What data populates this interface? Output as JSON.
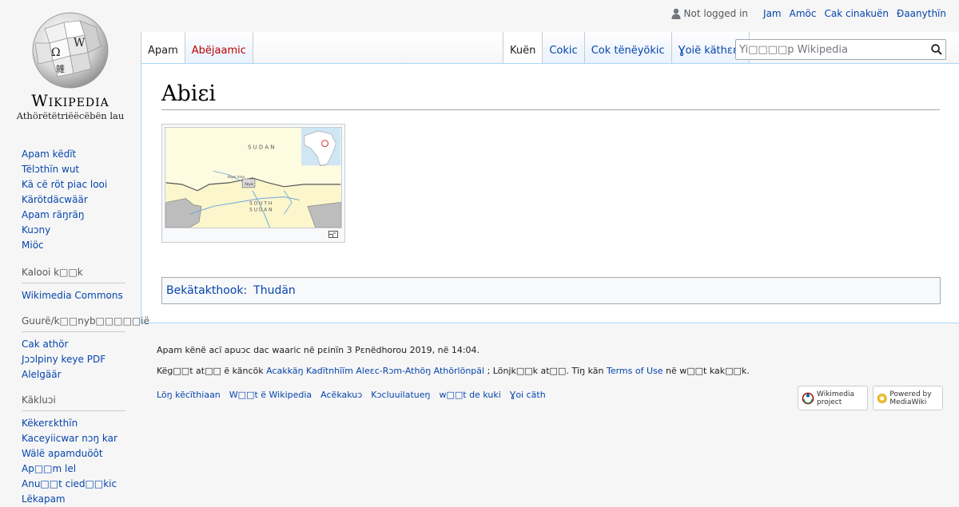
{
  "logo": {
    "wordmark": "Wikipedia",
    "tagline": "Athörëtëtriëëcëbën lau",
    "globe_glyphs": [
      "Ω",
      "W",
      "雑"
    ]
  },
  "personal": {
    "not_logged_in": "Not logged in",
    "links": [
      "Jam",
      "Amöc",
      "Cak cinakuën",
      "Ɖaanythïn"
    ]
  },
  "tabs_left": [
    {
      "label": "Apam",
      "selected": true,
      "new": false
    },
    {
      "label": "Abëjaamic",
      "selected": false,
      "new": true
    }
  ],
  "tabs_right": [
    {
      "label": "Kuën",
      "selected": true
    },
    {
      "label": "Cokic",
      "selected": false
    },
    {
      "label": "Cok tënëyökic",
      "selected": false
    },
    {
      "label": "Ɣoië käthɛɛr",
      "selected": false
    }
  ],
  "search": {
    "placeholder": "Yi□□□□p Wikipedia"
  },
  "article": {
    "title": "Abiɛi"
  },
  "map": {
    "labels": [
      "S U D A N",
      "Abyei Area",
      "Abyei",
      "S O U T H",
      "S U D A N"
    ]
  },
  "catlinks": {
    "label": "Bekätakthook",
    "categories": [
      "Thudän"
    ]
  },
  "sidebar": {
    "navigation": [
      "Apam këdït",
      "Tëlɔthïn wut",
      "Kä cë röt piac looi",
      "Kärötdäcwäär",
      "Apam räŋräŋ",
      "Kuɔny",
      "Miöc"
    ],
    "other_projects": {
      "heading": "Kalooi k□□k",
      "items": [
        "Wikimedia Commons"
      ]
    },
    "print": {
      "heading": "Guurë/k□□nyb□□□□□ië",
      "items": [
        "Cak athör",
        "Jɔɔlpiny keye PDF",
        "Alelgäär"
      ]
    },
    "tools": {
      "heading": "Käkluɔi",
      "items": [
        "Këkerɛkthïn",
        "Kaceyiicwar nɔŋ kar",
        "Wälë apamduöôt",
        "Ap□□m lel",
        "Anu□□t cied□□kic",
        "Lëkapam"
      ]
    }
  },
  "footer": {
    "last_modified": "Apam kënë acï apuɔc dac waaric në pɛinïn 3 Pɛnëdhorou 2019, në 14:04.",
    "license_pre": "Këg□□t at□□ ë käncök ",
    "license_link": "Acakkäŋ Kadïtnhïïm Aleɛc-Rɔm-Athöŋ Athörlönpäl",
    "license_mid": " ; Lönjk□□k at□□. Tïŋ kän ",
    "terms_link": "Terms of Use",
    "license_post": " në w□□t kak□□k.",
    "places": [
      "Löŋ këcïthiaan",
      "W□□t ë Wikipedia",
      "Acëkakuɔ",
      "Kɔcluuilatueŋ",
      "w□□t de kuki",
      "Ɣoi cäth"
    ],
    "badges": [
      "Wikimedia project",
      "Powered by MediaWiki"
    ]
  },
  "colors": {
    "link": "#0645ad",
    "new_link": "#ba0000",
    "border_blue": "#a7d7f9",
    "background": "#f6f6f6"
  }
}
